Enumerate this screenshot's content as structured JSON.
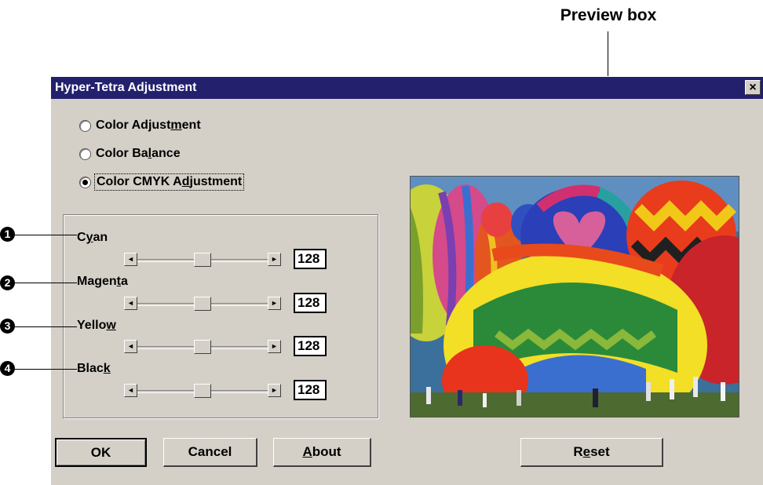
{
  "callout": {
    "label": "Preview box"
  },
  "dialog": {
    "title": "Hyper-Tetra Adjustment",
    "close_label": "×",
    "options": [
      {
        "pre": "Color Adjust",
        "accel": "m",
        "post": "ent",
        "checked": false
      },
      {
        "pre": "Color Ba",
        "accel": "l",
        "post": "ance",
        "checked": false
      },
      {
        "pre": "Color CMYK A",
        "accel": "d",
        "post": "justment",
        "checked": true
      }
    ],
    "sliders": [
      {
        "marker": "1",
        "pre": "C",
        "accel": "y",
        "post": "an",
        "value": "128",
        "level": 0.5
      },
      {
        "marker": "2",
        "pre": "Magen",
        "accel": "t",
        "post": "a",
        "value": "128",
        "level": 0.5
      },
      {
        "marker": "3",
        "pre": "Yello",
        "accel": "w",
        "post": "",
        "value": "128",
        "level": 0.5
      },
      {
        "marker": "4",
        "pre": "Blac",
        "accel": "k",
        "post": "",
        "value": "128",
        "level": 0.5
      }
    ],
    "scroll_left_icon": "◄",
    "scroll_right_icon": "►",
    "buttons": {
      "ok": "OK",
      "cancel": "Cancel",
      "about": {
        "pre": "",
        "accel": "A",
        "post": "bout"
      },
      "reset": {
        "pre": "R",
        "accel": "e",
        "post": "set"
      }
    }
  },
  "colors": {
    "titlebar": "#23206d",
    "dialog_bg": "#d4d0c8"
  }
}
